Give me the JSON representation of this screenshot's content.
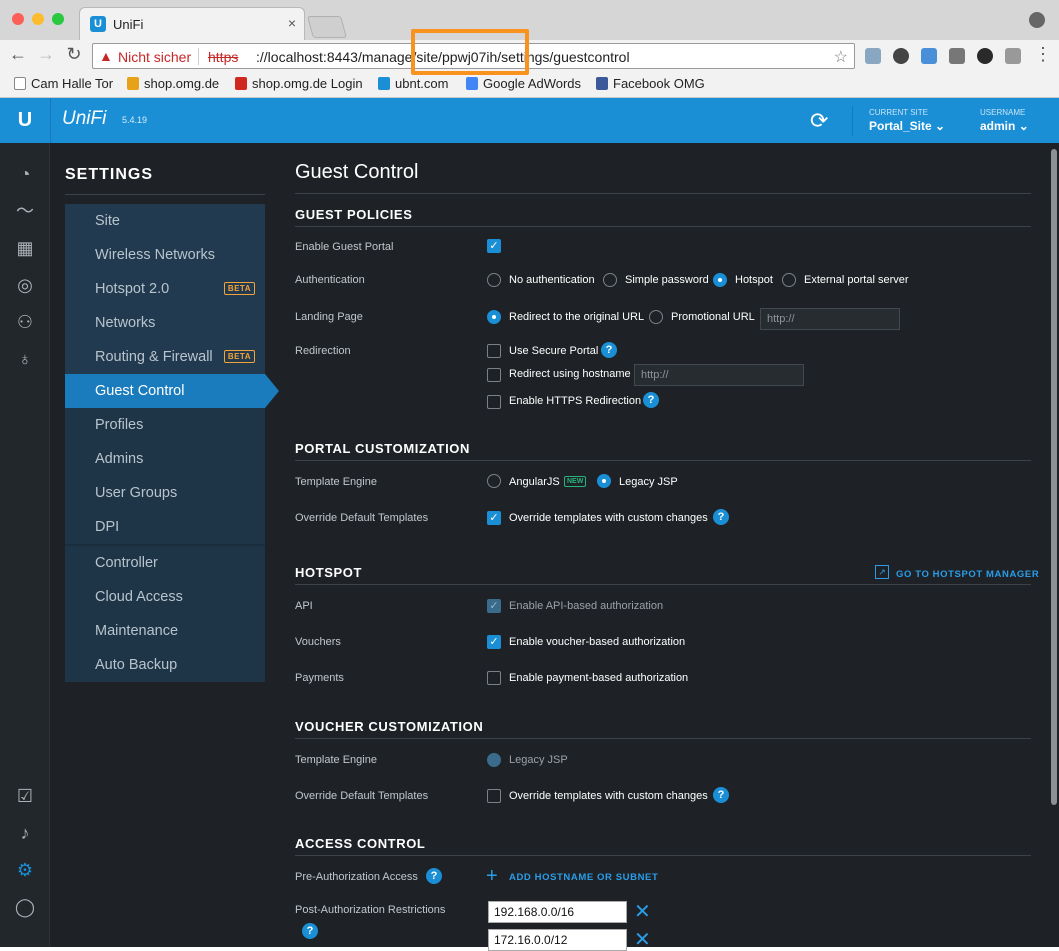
{
  "browser": {
    "tab_title": "UniFi",
    "tab_close": "×",
    "url_warning": "Nicht sicher",
    "url_protocol": "https",
    "url_rest": "://localhost:8443/manage/site/ppwj07ih/settings/guestcontrol",
    "bookmarks": [
      {
        "label": "Cam Halle Tor",
        "color": "#ffffff"
      },
      {
        "label": "shop.omg.de",
        "color": "#e8a21a"
      },
      {
        "label": "shop.omg.de Login",
        "color": "#d0281e"
      },
      {
        "label": "ubnt.com",
        "color": "#1a8fd6"
      },
      {
        "label": "Google AdWords",
        "color": "#4285f4"
      },
      {
        "label": "Facebook OMG",
        "color": "#3b5998"
      }
    ]
  },
  "topbar": {
    "logo": "UniFi",
    "version": "5.4.19",
    "current_site_label": "CURRENT SITE",
    "current_site_value": "Portal_Site",
    "username_label": "USERNAME",
    "username_value": "admin"
  },
  "settings_nav": {
    "heading": "SETTINGS",
    "items": [
      {
        "label": "Site"
      },
      {
        "label": "Wireless Networks"
      },
      {
        "label": "Hotspot 2.0",
        "badge": "BETA"
      },
      {
        "label": "Networks"
      },
      {
        "label": "Routing & Firewall",
        "badge": "BETA"
      },
      {
        "label": "Guest Control"
      },
      {
        "label": "Profiles"
      },
      {
        "label": "Admins"
      },
      {
        "label": "User Groups"
      },
      {
        "label": "DPI"
      },
      {
        "label": "Controller"
      },
      {
        "label": "Cloud Access"
      },
      {
        "label": "Maintenance"
      },
      {
        "label": "Auto Backup"
      }
    ],
    "active": "Guest Control"
  },
  "page": {
    "title": "Guest Control",
    "guest_policies": {
      "heading": "GUEST POLICIES",
      "enable_portal_label": "Enable Guest Portal",
      "authentication_label": "Authentication",
      "auth_options": [
        "No authentication",
        "Simple password",
        "Hotspot",
        "External portal server"
      ],
      "auth_selected": "Hotspot",
      "landing_label": "Landing Page",
      "landing_options": [
        "Redirect to the original URL",
        "Promotional URL"
      ],
      "landing_selected": "Redirect to the original URL",
      "promo_placeholder": "http://",
      "redirection_label": "Redirection",
      "use_secure_portal": "Use Secure Portal",
      "redirect_hostname": "Redirect using hostname",
      "hostname_placeholder": "http://",
      "https_redirect": "Enable HTTPS Redirection"
    },
    "portal_customization": {
      "heading": "PORTAL CUSTOMIZATION",
      "template_label": "Template Engine",
      "engine_angular": "AngularJS",
      "new_badge": "NEW",
      "engine_legacy": "Legacy JSP",
      "override_label": "Override Default Templates",
      "override_option": "Override templates with custom changes"
    },
    "hotspot": {
      "heading": "HOTSPOT",
      "manager_link": "GO TO HOTSPOT MANAGER",
      "api_label": "API",
      "api_option": "Enable API-based authorization",
      "vouchers_label": "Vouchers",
      "vouchers_option": "Enable voucher-based authorization",
      "payments_label": "Payments",
      "payments_option": "Enable payment-based authorization"
    },
    "voucher_customization": {
      "heading": "VOUCHER CUSTOMIZATION",
      "template_label": "Template Engine",
      "engine_legacy": "Legacy JSP",
      "override_label": "Override Default Templates",
      "override_option": "Override templates with custom changes"
    },
    "access_control": {
      "heading": "ACCESS CONTROL",
      "pre_auth_label": "Pre-Authorization Access",
      "add_link": "ADD HOSTNAME OR SUBNET",
      "post_auth_label": "Post-Authorization Restrictions",
      "restrictions": [
        "192.168.0.0/16",
        "172.16.0.0/12"
      ]
    }
  }
}
